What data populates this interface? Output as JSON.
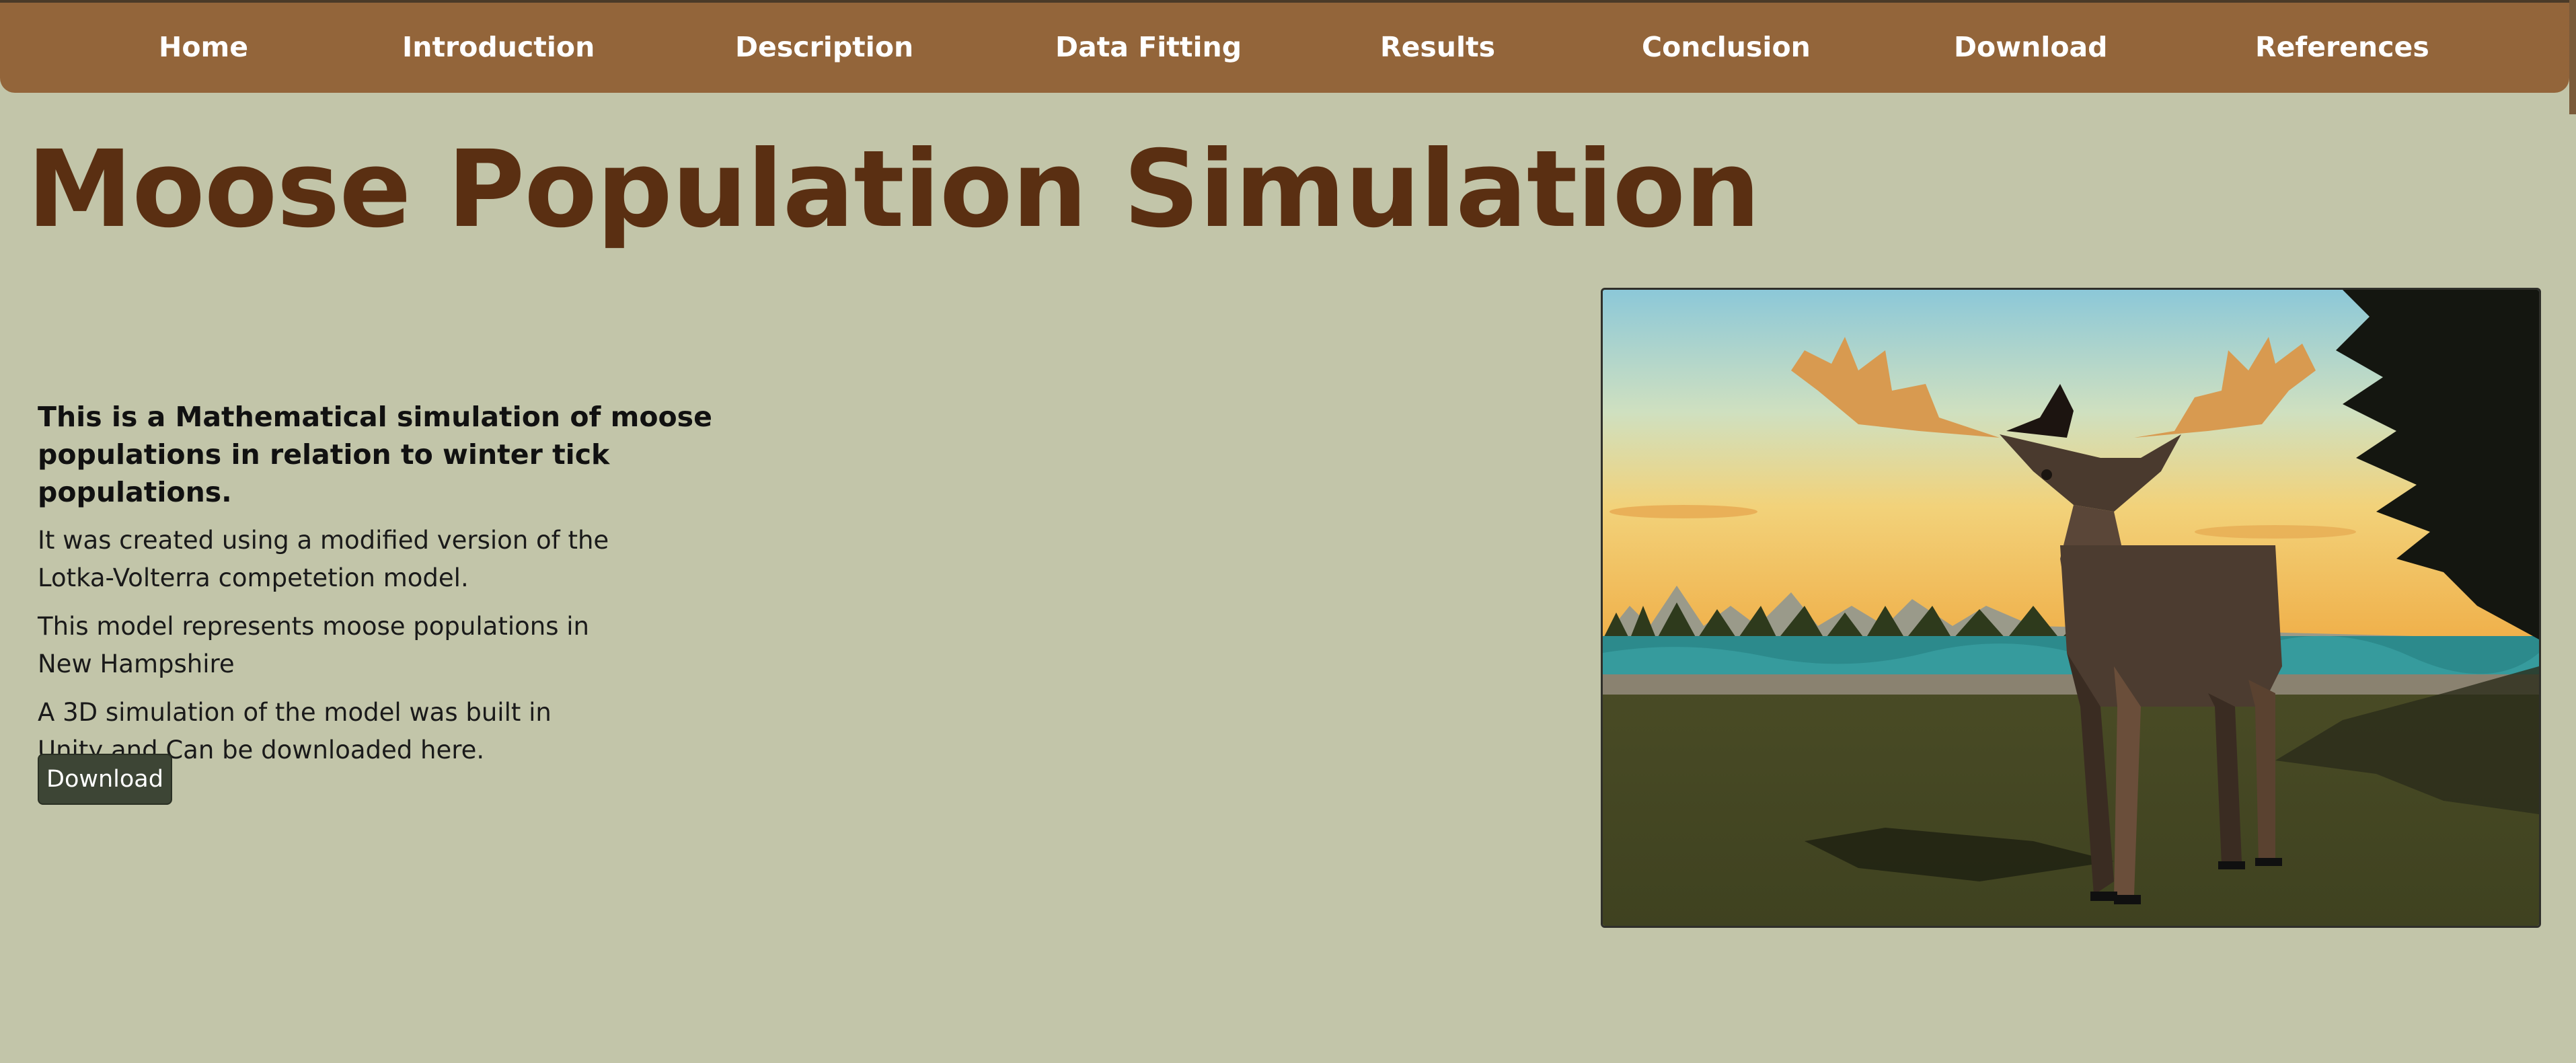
{
  "nav": {
    "items": [
      {
        "label": "Home"
      },
      {
        "label": "Introduction"
      },
      {
        "label": "Description"
      },
      {
        "label": "Data Fitting"
      },
      {
        "label": "Results"
      },
      {
        "label": "Conclusion"
      },
      {
        "label": "Download"
      },
      {
        "label": "References"
      }
    ]
  },
  "header": {
    "title": "Moose Population Simulation"
  },
  "intro": {
    "lead": "This is a Mathematical simulation of moose populations in relation to winter tick populations.",
    "paragraphs": [
      "It was created using a modified version of the Lotka-Volterra competetion model.",
      "This model represents moose populations in New Hampshire",
      "A 3D simulation of the model was built in Unity and Can be downloaded here."
    ],
    "download_label": "Download"
  },
  "colors": {
    "nav_background": "#93653a",
    "page_background": "#c2c5a9",
    "title": "#5a2f12",
    "button": "#3d4535"
  },
  "image": {
    "icon": "moose-3d-scene-image"
  }
}
